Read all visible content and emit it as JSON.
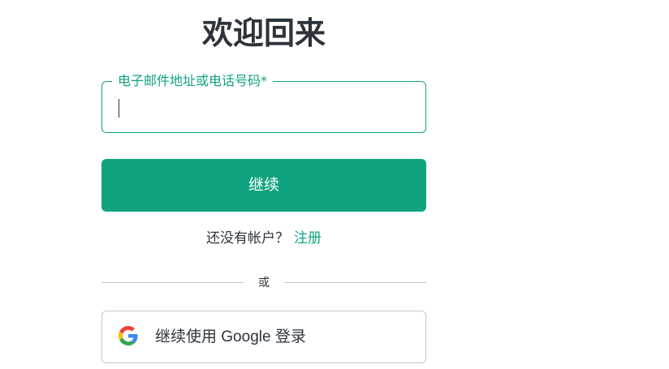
{
  "header": {
    "title": "欢迎回来"
  },
  "login_form": {
    "email_label": "电子邮件地址或电话号码*",
    "email_value": "",
    "continue_label": "继续",
    "signup_prompt": "还没有帐户？",
    "signup_link": "注册",
    "divider_text": "或",
    "google_label": "继续使用 Google 登录"
  },
  "colors": {
    "accent": "#10a37f",
    "text": "#2d333a",
    "border": "#c2c8d0"
  },
  "icons": {
    "google": "google-logo-icon"
  }
}
